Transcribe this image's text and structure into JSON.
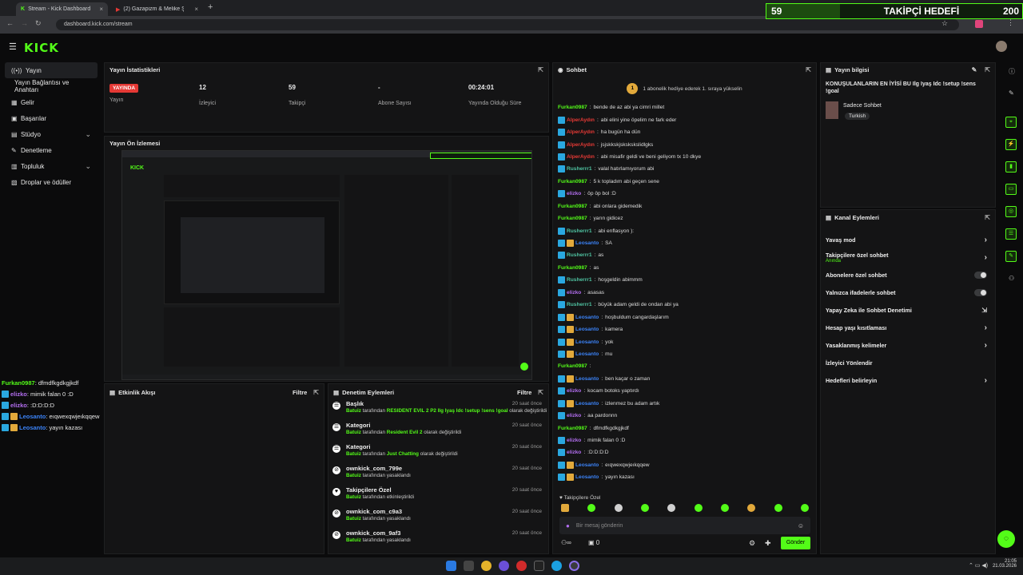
{
  "browser": {
    "tabs": [
      {
        "title": "Stream - Kick Dashboard"
      },
      {
        "title": "(2) Gazapizm & Melike Şa..."
      }
    ],
    "url": "dashboard.kick.com/stream"
  },
  "goal": {
    "current": "59",
    "label": "TAKİPÇİ HEDEFİ",
    "target": "200"
  },
  "brand": {
    "logo_text": "KICK",
    "accent": "#53fc18"
  },
  "sidebar": {
    "items": [
      {
        "label": "Yayın",
        "icon": "broadcast-icon"
      },
      {
        "label": "Yayın Bağlantısı ve Anahtarı",
        "icon": ""
      },
      {
        "label": "Gelir",
        "icon": "money-icon"
      },
      {
        "label": "Başarılar",
        "icon": "trophy-icon"
      },
      {
        "label": "Stüdyo",
        "icon": "studio-icon"
      },
      {
        "label": "Denetleme",
        "icon": "wrench-icon"
      },
      {
        "label": "Topluluk",
        "icon": "community-icon"
      },
      {
        "label": "Droplar ve ödüller",
        "icon": "gift-icon"
      }
    ]
  },
  "mini_chat": [
    {
      "user": "Furkan0987",
      "msg": ": dfmdfkgdkgjkdf"
    },
    {
      "user": "elizko",
      "msg": ": mimik falan 0 :D"
    },
    {
      "user": "elizko",
      "msg": ": :D:D:D:D"
    },
    {
      "user": "Leosanto",
      "msg": ": eıqwexqwjeıkqqew"
    },
    {
      "user": "Leosanto",
      "msg": ": yayın kazası"
    }
  ],
  "stats": {
    "title": "Yayın İstatistikleri",
    "live_badge": "YAYINDA",
    "live_label": "Yayın",
    "viewers": "12",
    "viewers_label": "İzleyici",
    "followers": "59",
    "followers_label": "Takipçi",
    "subs": "-",
    "subs_label": "Abone Sayısı",
    "uptime": "00:24:01",
    "uptime_label": "Yayında Olduğu Süre"
  },
  "preview": {
    "title": "Yayın Ön İzlemesi"
  },
  "activity": {
    "title": "Etkinlik Akışı",
    "filter": "Filtre"
  },
  "mod_actions": {
    "title": "Denetim Eylemleri",
    "filter": "Filtre",
    "items": [
      {
        "title": "Başlık",
        "actor": "Batuiz",
        "pre": " tarafından ",
        "value": "RESIDENT EVIL 2 P2 Ilg Iyaş Idc !setup !sens !goal",
        "post": " olarak değiştirildi",
        "time": "20 saat önce"
      },
      {
        "title": "Kategori",
        "actor": "Batuiz",
        "pre": " tarafından ",
        "value": "Resident Evil 2",
        "post": " olarak değiştirildi",
        "time": "20 saat önce"
      },
      {
        "title": "Kategori",
        "actor": "Batuiz",
        "pre": " tarafından ",
        "value": "Just Chatting",
        "post": " olarak değiştirildi",
        "time": "20 saat önce"
      },
      {
        "title": "ownkick_com_799e",
        "actor": "Batuiz",
        "pre": " tarafından yasaklandı",
        "value": "",
        "post": "",
        "time": "20 saat önce"
      },
      {
        "title": "Takipçilere Özel",
        "actor": "Batuiz",
        "pre": " tarafından etkinleştirildi",
        "value": "",
        "post": "",
        "time": "20 saat önce"
      },
      {
        "title": "ownkick_com_c9a3",
        "actor": "Batuiz",
        "pre": " tarafından yasaklandı",
        "value": "",
        "post": "",
        "time": "20 saat önce"
      },
      {
        "title": "ownkick_com_9af3",
        "actor": "Batuiz",
        "pre": " tarafından yasaklandı",
        "value": "",
        "post": "",
        "time": "20 saat önce"
      }
    ]
  },
  "chat": {
    "title": "Sohbet",
    "pinned": "1 abonelik hediye ederek 1. sıraya yükselin",
    "followers_only": "Takipçilere Özel",
    "input_placeholder": "Bir mesaj gönderin",
    "send": "Gönder",
    "count": "0",
    "messages": [
      {
        "user": "Furkan0987",
        "color": "#53fc18",
        "msg": "bende de az abi ya cimri millet",
        "icons": 0
      },
      {
        "user": "AlperAydın",
        "color": "#e53935",
        "msg": "abi elini yine öpelim ne fark eder",
        "icons": 1
      },
      {
        "user": "AlperAydın",
        "color": "#e53935",
        "msg": "ha bugün ha dün",
        "icons": 1
      },
      {
        "user": "AlperAydın",
        "color": "#e53935",
        "msg": "jsjskkskjskskskslidlgks",
        "icons": 1
      },
      {
        "user": "AlperAydın",
        "color": "#e53935",
        "msg": "abi misafir geldi ve beni geliyom tx 10 dkye",
        "icons": 1
      },
      {
        "user": "Rusherrr1",
        "color": "#4fc3a1",
        "msg": "valal hatırlamıyorum abi",
        "icons": 1
      },
      {
        "user": "Furkan0987",
        "color": "#53fc18",
        "msg": "5 k topladım abi geçen sene",
        "icons": 0
      },
      {
        "user": "elizko",
        "color": "#b36ef0",
        "msg": "öp öp bol :D",
        "icons": 1
      },
      {
        "user": "Furkan0987",
        "color": "#53fc18",
        "msg": "abi onlara gidemedik",
        "icons": 0
      },
      {
        "user": "Furkan0987",
        "color": "#53fc18",
        "msg": "yarın gidicez",
        "icons": 0
      },
      {
        "user": "Rusherrr1",
        "color": "#4fc3a1",
        "msg": "abi enflasyon ):",
        "icons": 1
      },
      {
        "user": "Leosanto",
        "color": "#3b82f6",
        "msg": "SA",
        "icons": 2
      },
      {
        "user": "Rusherrr1",
        "color": "#4fc3a1",
        "msg": "as",
        "icons": 1
      },
      {
        "user": "Furkan0987",
        "color": "#53fc18",
        "msg": "as",
        "icons": 0
      },
      {
        "user": "Rusherrr1",
        "color": "#4fc3a1",
        "msg": "hoşgeldin abimmm",
        "icons": 1
      },
      {
        "user": "elizko",
        "color": "#b36ef0",
        "msg": "asasas",
        "icons": 1
      },
      {
        "user": "Rusherrr1",
        "color": "#4fc3a1",
        "msg": "büyük adam geldi de ondan abi ya",
        "icons": 1
      },
      {
        "user": "Leosanto",
        "color": "#3b82f6",
        "msg": "hoşbuldum cangardaşlarım",
        "icons": 2
      },
      {
        "user": "Leosanto",
        "color": "#3b82f6",
        "msg": "kamera",
        "icons": 2
      },
      {
        "user": "Leosanto",
        "color": "#3b82f6",
        "msg": "yok",
        "icons": 2
      },
      {
        "user": "Leosanto",
        "color": "#3b82f6",
        "msg": "mu",
        "icons": 2
      },
      {
        "user": "Furkan0987",
        "color": "#53fc18",
        "msg": "",
        "icons": 0
      },
      {
        "user": "Leosanto",
        "color": "#3b82f6",
        "msg": "ben kaçar o zaman",
        "icons": 2
      },
      {
        "user": "elizko",
        "color": "#b36ef0",
        "msg": "kocam botoks yaptırdı",
        "icons": 1
      },
      {
        "user": "Leosanto",
        "color": "#3b82f6",
        "msg": "izlenmez bu adam artık",
        "icons": 2
      },
      {
        "user": "elizko",
        "color": "#b36ef0",
        "msg": "aa pardonnn",
        "icons": 1
      },
      {
        "user": "Furkan0987",
        "color": "#53fc18",
        "msg": "dfmdfkgdkgjkdf",
        "icons": 0
      },
      {
        "user": "elizko",
        "color": "#b36ef0",
        "msg": "mimik falan 0 :D",
        "icons": 1
      },
      {
        "user": "elizko",
        "color": "#b36ef0",
        "msg": ":D:D:D:D",
        "icons": 1
      },
      {
        "user": "Leosanto",
        "color": "#3b82f6",
        "msg": "eıqwexqwjeıkqqew",
        "icons": 2
      },
      {
        "user": "Leosanto",
        "color": "#3b82f6",
        "msg": "yayın kazası",
        "icons": 2
      }
    ]
  },
  "stream_info": {
    "title": "Yayın bilgisi",
    "stream_title": "KONUŞULANLARIN EN İYİSİ BU Ilg Iyaş Idc !setup !sens !goal",
    "category": "Sadece Sohbet",
    "tag": "Turkish"
  },
  "channel_actions": {
    "title": "Kanal Eylemleri",
    "items": [
      {
        "label": "Yavaş mod",
        "sub": "",
        "ctrl": "arrow"
      },
      {
        "label": "Takipçilere özel sohbet",
        "sub": "Anında",
        "ctrl": "arrow"
      },
      {
        "label": "Abonelere özel sohbet",
        "sub": "",
        "ctrl": "toggle"
      },
      {
        "label": "Yalnızca ifadelerle sohbet",
        "sub": "",
        "ctrl": "toggle"
      },
      {
        "label": "Yapay Zeka ile Sohbet Denetimi",
        "sub": "",
        "ctrl": "ext"
      },
      {
        "label": "Hesap yaşı kısıtlaması",
        "sub": "",
        "ctrl": "arrow"
      },
      {
        "label": "Yasaklanmış kelimeler",
        "sub": "",
        "ctrl": "arrow"
      },
      {
        "label": "İzleyici Yönlendir",
        "sub": "",
        "ctrl": ""
      },
      {
        "label": "Hedefleri belirleyin",
        "sub": "",
        "ctrl": "arrow"
      }
    ]
  },
  "taskbar": {
    "time": "21:05",
    "date": "21.03.2026"
  }
}
